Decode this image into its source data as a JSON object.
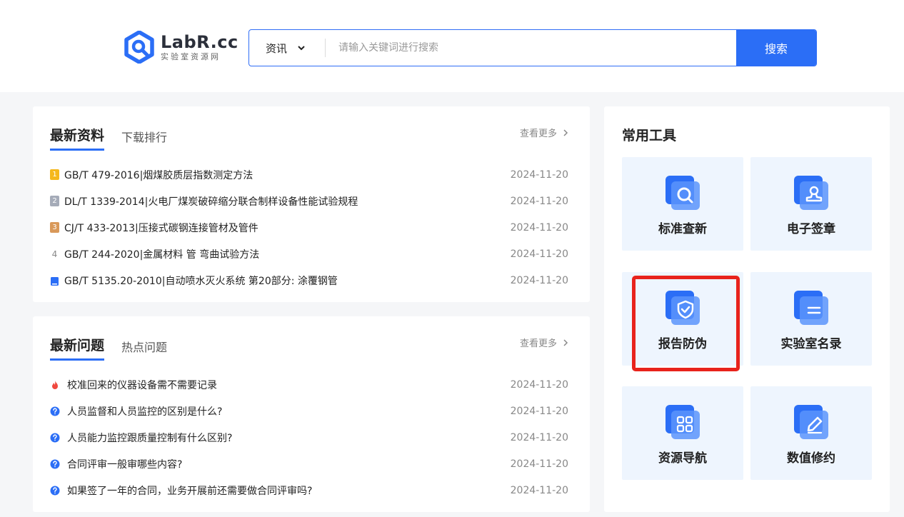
{
  "header": {
    "logo_title": "LabR.cc",
    "logo_subtitle": "实验室资源网",
    "search_category": "资讯",
    "search_placeholder": "请输入关键词进行搜索",
    "search_button": "搜索"
  },
  "docs": {
    "tab_active": "最新资料",
    "tab_other": "下载排行",
    "more": "查看更多",
    "items": [
      {
        "badge": "1",
        "title": "GB/T 479-2016|烟煤胶质层指数测定方法",
        "date": "2024-11-20"
      },
      {
        "badge": "2",
        "title": "DL/T 1339-2014|火电厂煤炭破碎缩分联合制样设备性能试验规程",
        "date": "2024-11-20"
      },
      {
        "badge": "3",
        "title": "CJ/T 433-2013|压接式碳钢连接管材及管件",
        "date": "2024-11-20"
      },
      {
        "badge": "4",
        "title": "GB/T 244-2020|金属材料 管 弯曲试验方法",
        "date": "2024-11-20"
      },
      {
        "badge": "",
        "title": "GB/T 5135.20-2010|自动喷水灭火系统 第20部分: 涂覆钢管",
        "date": "2024-11-20"
      }
    ]
  },
  "qa": {
    "tab_active": "最新问题",
    "tab_other": "热点问题",
    "more": "查看更多",
    "items": [
      {
        "title": "校准回来的仪器设备需不需要记录",
        "date": "2024-11-20"
      },
      {
        "title": "人员监督和人员监控的区别是什么?",
        "date": "2024-11-20"
      },
      {
        "title": "人员能力监控跟质量控制有什么区别?",
        "date": "2024-11-20"
      },
      {
        "title": "合同评审一般审哪些内容?",
        "date": "2024-11-20"
      },
      {
        "title": "如果签了一年的合同，业务开展前还需要做合同评审吗?",
        "date": "2024-11-20"
      }
    ]
  },
  "tools": {
    "title": "常用工具",
    "items": [
      {
        "label": "标准查新",
        "icon": "search-icon"
      },
      {
        "label": "电子签章",
        "icon": "stamp-icon"
      },
      {
        "label": "报告防伪",
        "icon": "shield-check-icon"
      },
      {
        "label": "实验室名录",
        "icon": "document-list-icon"
      },
      {
        "label": "资源导航",
        "icon": "grid-icon"
      },
      {
        "label": "数值修约",
        "icon": "pencil-icon"
      }
    ]
  },
  "colors": {
    "accent": "#2b6ef6",
    "highlight": "#e8231c",
    "tile_bg": "#eef5fe"
  }
}
